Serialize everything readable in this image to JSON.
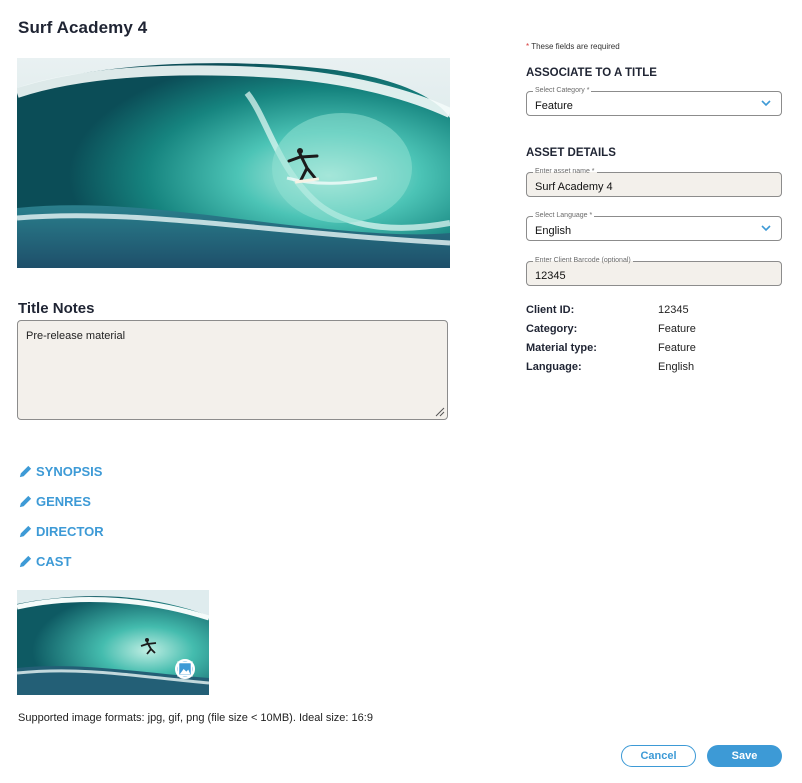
{
  "page": {
    "title": "Surf Academy 4"
  },
  "notes": {
    "heading": "Title Notes",
    "value": "Pre-release material"
  },
  "edit_links": [
    {
      "label": "SYNOPSIS",
      "icon": "pencil-icon"
    },
    {
      "label": "GENRES",
      "icon": "pencil-icon"
    },
    {
      "label": "DIRECTOR",
      "icon": "pencil-icon"
    },
    {
      "label": "CAST",
      "icon": "pencil-icon"
    }
  ],
  "image_upload": {
    "badge_icon": "image-edit-icon",
    "formats_note": "Supported image formats: jpg, gif, png (file size < 10MB). Ideal size: 16:9"
  },
  "actions": {
    "cancel_label": "Cancel",
    "save_label": "Save"
  },
  "form": {
    "required_star": "*",
    "required_note": "These fields are required",
    "associate_heading": "ASSOCIATE TO A TITLE",
    "category": {
      "label": "Select Category *",
      "value": "Feature"
    },
    "asset_heading": "ASSET DETAILS",
    "asset_name": {
      "label": "Enter asset name *",
      "value": "Surf Academy 4"
    },
    "language": {
      "label": "Select Language *",
      "value": "English"
    },
    "barcode": {
      "label": "Enter Client Barcode (optional)",
      "value": "12345"
    }
  },
  "info": [
    {
      "label": "Client ID:",
      "value": "12345"
    },
    {
      "label": "Category:",
      "value": "Feature"
    },
    {
      "label": "Material type:",
      "value": "Feature"
    },
    {
      "label": "Language:",
      "value": "English"
    }
  ],
  "colors": {
    "accent": "#3d9ad6",
    "field_bg": "#f3f0eb",
    "required": "#d63c3c"
  }
}
